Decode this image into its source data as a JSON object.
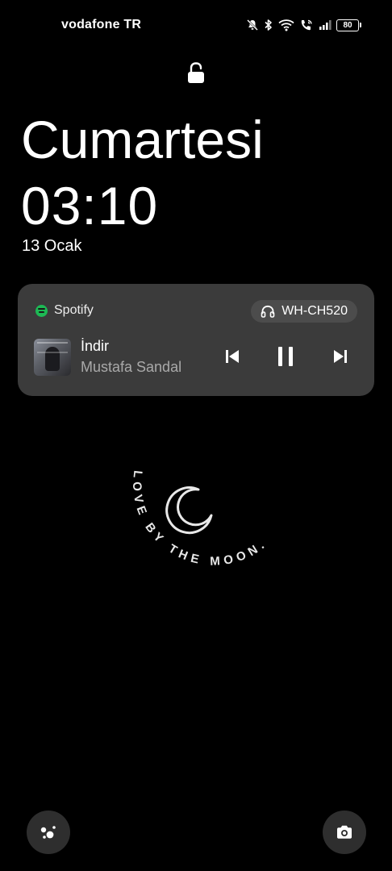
{
  "status_bar": {
    "carrier": "vodafone TR",
    "battery_level": "80",
    "icons": [
      "mute-bell-icon",
      "bluetooth-icon",
      "wifi-icon",
      "wifi-calling-icon",
      "signal-icon",
      "battery-icon"
    ]
  },
  "lock": {
    "icon": "lock-open-icon"
  },
  "clock": {
    "day_name": "Cumartesi",
    "time": "03:10",
    "date": "13 Ocak"
  },
  "media": {
    "app_name": "Spotify",
    "app_color": "#1db954",
    "output_device": "WH-CH520",
    "track_title": "İndir",
    "artist": "Mustafa Sandal",
    "controls": [
      "previous",
      "pause",
      "next"
    ],
    "card_color": "#3b3b3b"
  },
  "wallpaper": {
    "text": "LOVE BY THE MOON.",
    "icon": "crescent-moon-icon"
  },
  "shortcuts": {
    "left_icon": "assistant-icon",
    "right_icon": "camera-icon"
  }
}
